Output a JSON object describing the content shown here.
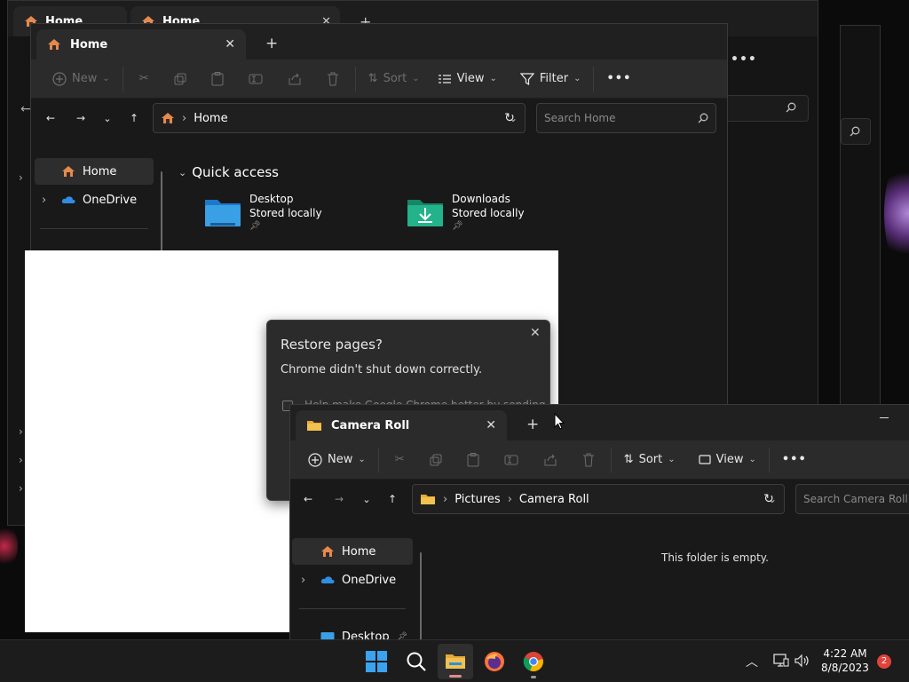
{
  "background_windows": {
    "tab1_label": "Home",
    "tab2_label": "Home"
  },
  "home_window": {
    "tab_label": "Home",
    "toolbar": {
      "new_label": "New",
      "sort_label": "Sort",
      "view_label": "View",
      "filter_label": "Filter"
    },
    "address": {
      "crumb": "Home"
    },
    "search_placeholder": "Search Home",
    "sidebar": {
      "items": [
        {
          "label": "Home"
        },
        {
          "label": "OneDrive"
        }
      ]
    },
    "quick_access": {
      "heading": "Quick access",
      "items": [
        {
          "name": "Desktop",
          "status": "Stored locally",
          "icon": "desktop-folder-icon",
          "color": "#3aa0e6"
        },
        {
          "name": "Downloads",
          "status": "Stored locally",
          "icon": "downloads-folder-icon",
          "color": "#23b38a"
        }
      ]
    }
  },
  "chrome_dialog": {
    "title": "Restore pages?",
    "message": "Chrome didn't shut down correctly.",
    "checkbox_label": "Help make Google Chrome better by sending"
  },
  "camera_window": {
    "tab_label": "Camera Roll",
    "toolbar": {
      "new_label": "New",
      "sort_label": "Sort",
      "view_label": "View"
    },
    "address": {
      "crumbs": [
        "Pictures",
        "Camera Roll"
      ]
    },
    "search_placeholder": "Search Camera Roll",
    "sidebar": {
      "items": [
        {
          "label": "Home"
        },
        {
          "label": "OneDrive"
        },
        {
          "label": "Desktop"
        }
      ]
    },
    "empty_message": "This folder is empty."
  },
  "taskbar": {
    "time": "4:22 AM",
    "date": "8/8/2023",
    "notification_count": "2",
    "apps": [
      "start-icon",
      "search-icon",
      "file-explorer-icon",
      "firefox-icon",
      "chrome-icon"
    ]
  },
  "colors": {
    "folder_yellow": "#f2c14e",
    "onedrive_blue": "#2f8de4",
    "home_orange": "#e58a4e",
    "badge_red": "#e0433a"
  }
}
